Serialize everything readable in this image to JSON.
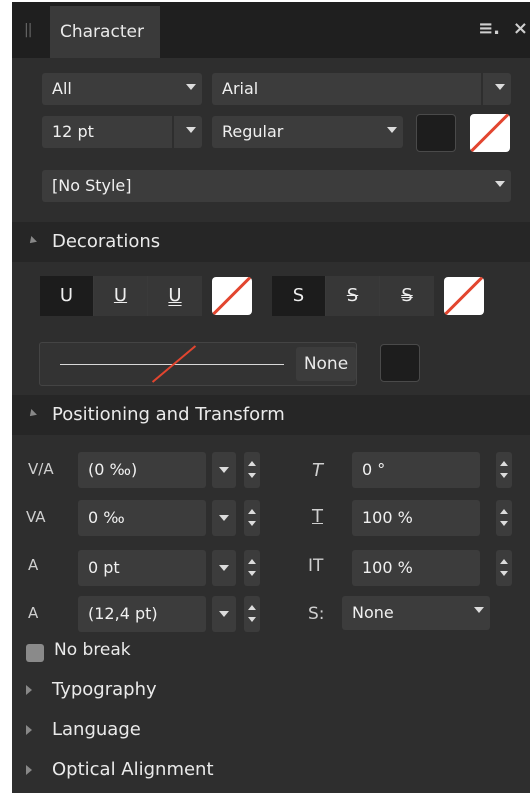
{
  "tab": {
    "title": "Character"
  },
  "row1": {
    "scope": "All",
    "font": "Arial"
  },
  "row2": {
    "size": "12 pt",
    "weight": "Regular"
  },
  "row3": {
    "style": "[No Style]"
  },
  "decorations": {
    "title": "Decorations",
    "underline_buttons": [
      "U",
      "U",
      "U"
    ],
    "strike_buttons": [
      "S",
      "S",
      "S"
    ],
    "line_label": "None"
  },
  "positioning": {
    "title": "Positioning and Transform",
    "left": [
      {
        "icon": "V/A",
        "value": "(0 ‰)"
      },
      {
        "icon": "VA",
        "value": "0 ‰"
      },
      {
        "icon": "A",
        "value": "0 pt"
      },
      {
        "icon": "A",
        "value": "(12,4 pt)"
      }
    ],
    "right": [
      {
        "icon": "T",
        "value": "0 °"
      },
      {
        "icon": "T",
        "value": "100 %"
      },
      {
        "icon": "IT",
        "value": "100 %"
      },
      {
        "icon": "S:",
        "value": "None"
      }
    ]
  },
  "no_break": {
    "label": "No break"
  },
  "collapsed_sections": [
    "Typography",
    "Language",
    "Optical Alignment"
  ],
  "colors": {
    "panel": "#2e2e2e",
    "accent_none": "#e2452f"
  }
}
